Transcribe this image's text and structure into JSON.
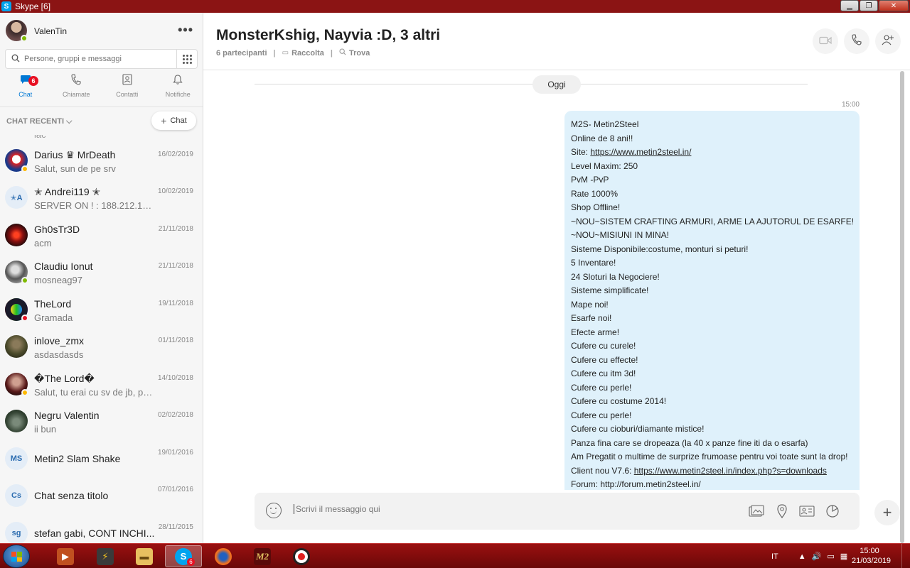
{
  "window": {
    "title": "Skype [6]"
  },
  "profile": {
    "name": "ValenTin",
    "presence_color": "#7fba00"
  },
  "search": {
    "placeholder": "Persone, gruppi e messaggi"
  },
  "nav": {
    "tabs": [
      {
        "label": "Chat",
        "badge": "6",
        "active": true
      },
      {
        "label": "Chiamate"
      },
      {
        "label": "Contatti"
      },
      {
        "label": "Notifiche"
      }
    ]
  },
  "recent": {
    "header": "CHAT RECENTI",
    "new_chat_label": "Chat",
    "cut_text": "lac"
  },
  "chats": [
    {
      "name": "Darius ♛ MrDeath",
      "preview": "Salut, sun de pe srv",
      "date": "16/02/2019",
      "avatar_color": "#1a3a8a",
      "presence": "#ffb900"
    },
    {
      "name": "✭ Andrei119 ✭",
      "preview": "SERVER ON ! : 188.212.100....",
      "date": "10/02/2019",
      "initials": "✭A"
    },
    {
      "name": "Gh0sTr3D",
      "preview": "acm",
      "date": "21/11/2018",
      "avatar_color": "#8a1010"
    },
    {
      "name": "Claudiu Ionut",
      "preview": "mosneag97",
      "date": "21/11/2018",
      "avatar_color": "#555555",
      "presence": "#7fba00"
    },
    {
      "name": "TheLord",
      "preview": "Gramada",
      "date": "19/11/2018",
      "avatar_color": "#2a1a3a",
      "presence": "#e81123"
    },
    {
      "name": "inlove_zmx",
      "preview": "asdasdasds",
      "date": "01/11/2018",
      "avatar_color": "#4a4a2a"
    },
    {
      "name": "�The Lord�",
      "preview": "Salut, tu erai cu sv de jb, pa...",
      "date": "14/10/2018",
      "avatar_color": "#5a1a1a",
      "presence": "#ffb900"
    },
    {
      "name": "Negru Valentin",
      "preview": "ii bun",
      "date": "02/02/2018",
      "avatar_color": "#3a4a3a"
    },
    {
      "name": "Metin2 Slam Shake",
      "preview": "",
      "date": "19/01/2016",
      "initials": "MS"
    },
    {
      "name": "Chat senza titolo",
      "preview": "",
      "date": "07/01/2016",
      "initials": "Cs"
    },
    {
      "name": "stefan gabi, CONT INCHI...",
      "preview": "",
      "date": "28/11/2015",
      "initials": "sg"
    }
  ],
  "conversation": {
    "title": "MonsterKshig, Nayvia :D, 3 altri",
    "participants": "6 partecipanti",
    "gallery": "Raccolta",
    "find": "Trova",
    "day": "Oggi",
    "time": "15:00",
    "message_lines": [
      "M2S- Metin2Steel",
      "Online de 8 ani!!",
      "Site: ",
      "Level Maxim: 250",
      "PvM -PvP",
      "Rate 1000%",
      "Shop Offline!",
      "~NOU~SISTEM CRAFTING ARMURI, ARME LA AJUTORUL DE ESARFE!",
      "~NOU~MISIUNI IN MINA!",
      "Sisteme Disponibile:costume, monturi si peturi!",
      "5 Inventare!",
      "24 Sloturi la Negociere!",
      "Sisteme simplificate!",
      "Mape noi!",
      "Esarfe noi!",
      "Efecte arme!",
      "Cufere cu curele!",
      "Cufere cu effecte!",
      "Cufere cu itm 3d!",
      "Cufere cu perle!",
      "Cufere cu costume 2014!",
      "Cufere cu perle!",
      "Cufere cu cioburi/diamante mistice!",
      "Panza fina care se dropeaza (la 40 x panze fine iti da o esarfa)",
      "Am Pregatit o multime de surprize frumoase pentru voi toate sunt la drop!",
      "Client nou V7.6: ",
      "Forum: http://forum.metin2steel.in/"
    ],
    "site_link": "https://www.metin2steel.in/",
    "client_link": "https://www.metin2steel.in/index.php?s=downloads"
  },
  "composer": {
    "placeholder": "Scrivi il messaggio qui"
  },
  "taskbar": {
    "lang": "IT",
    "time": "15:00",
    "date": "21/03/2019",
    "skype_badge": "6"
  }
}
